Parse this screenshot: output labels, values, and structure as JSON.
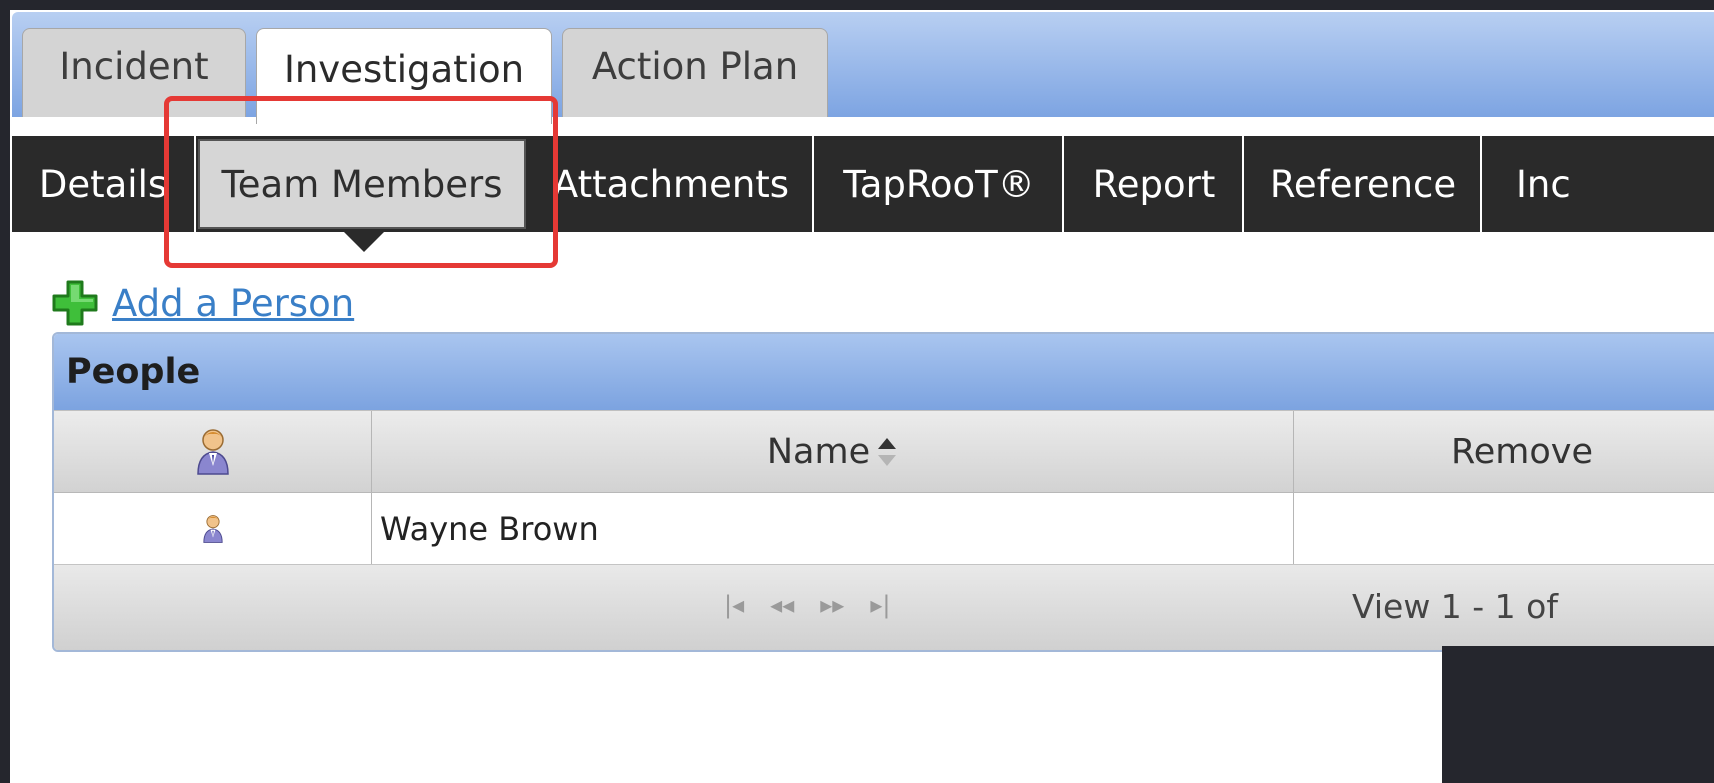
{
  "tabs": [
    {
      "label": "Incident",
      "active": false
    },
    {
      "label": "Investigation",
      "active": true
    },
    {
      "label": "Action Plan",
      "active": false
    }
  ],
  "subnav": [
    {
      "label": "Details"
    },
    {
      "label": "Team Members",
      "selected": true
    },
    {
      "label": "Attachments"
    },
    {
      "label": "TapRooT®"
    },
    {
      "label": "Report"
    },
    {
      "label": "Reference"
    },
    {
      "label": "Inc"
    }
  ],
  "add_link": {
    "label": "Add a Person",
    "icon": "plus-icon"
  },
  "grid": {
    "title": "People",
    "columns": {
      "icon": "person-icon",
      "name": "Name",
      "remove": "Remove"
    },
    "rows": [
      {
        "icon": "person-icon",
        "name": "Wayne Brown",
        "remove": ""
      }
    ],
    "pager": {
      "first": "|◂",
      "prev": "◂◂",
      "next": "▸▸",
      "last": "▸|"
    },
    "view_text": "View 1 - 1 of"
  },
  "colors": {
    "highlight": "#e53935",
    "tabbar": "#7da4e2",
    "subnav": "#2a2a2a",
    "link": "#3a7fc7"
  }
}
